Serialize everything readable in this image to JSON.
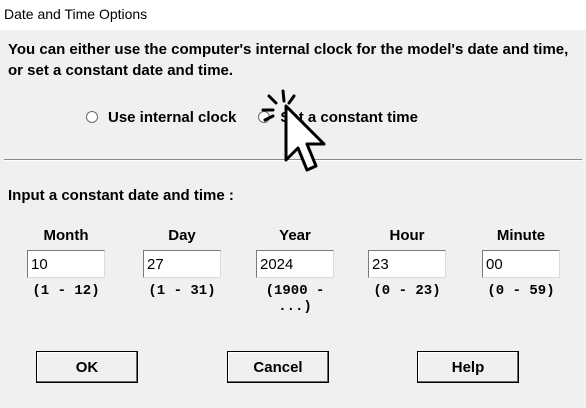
{
  "window": {
    "title": "Date and Time Options"
  },
  "intro_text": "You can either use the computer's internal clock for the model's date and time, or set a constant date and time.",
  "options": [
    {
      "label": "Use internal clock",
      "selected": false
    },
    {
      "label": "Set a constant time",
      "selected": false
    }
  ],
  "constant_section_label": "Input a constant date and time :",
  "fields": [
    {
      "label": "Month",
      "value": "10",
      "range": "(1 - 12)"
    },
    {
      "label": "Day",
      "value": "27",
      "range": "(1 - 31)"
    },
    {
      "label": "Year",
      "value": "2024",
      "range": "(1900 - ...)"
    },
    {
      "label": "Hour",
      "value": "23",
      "range": "(0 - 23)"
    },
    {
      "label": "Minute",
      "value": "00",
      "range": "(0 - 59)"
    }
  ],
  "buttons": {
    "ok": "OK",
    "cancel": "Cancel",
    "help": "Help"
  },
  "cursor": {
    "icon": "pointer-click-icon"
  },
  "colors": {
    "dialog_bg": "#f0f0f0",
    "titlebar_bg": "#ffffff",
    "text": "#000000"
  }
}
